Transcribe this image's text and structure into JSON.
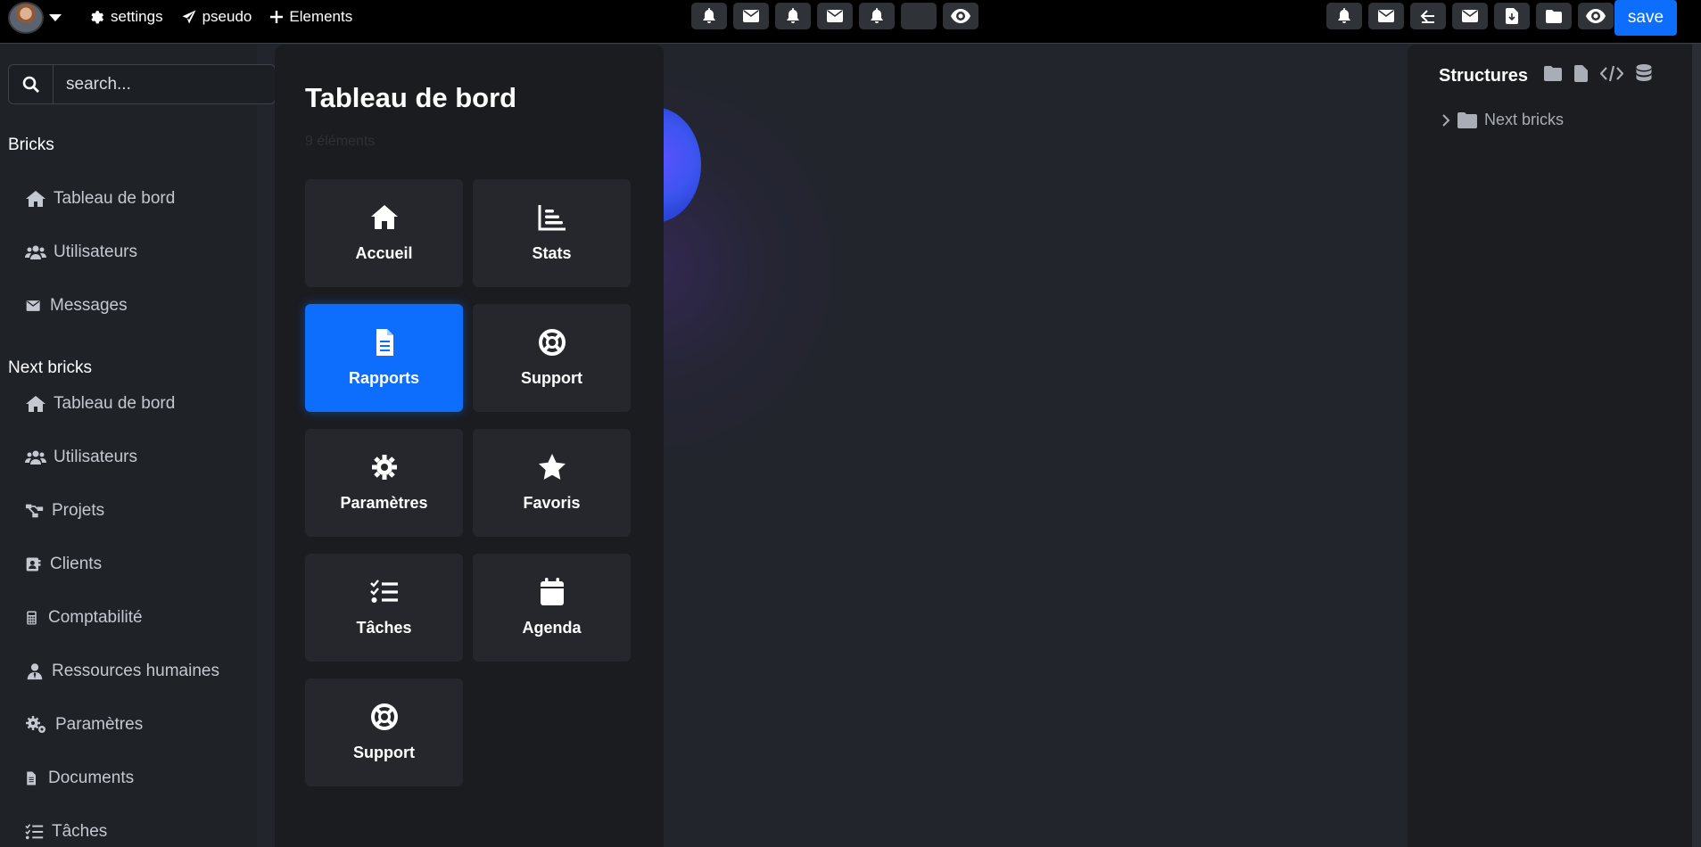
{
  "topbar": {
    "nav": [
      {
        "icon": "gear-icon",
        "label": "settings"
      },
      {
        "icon": "paper-plane-icon",
        "label": "pseudo"
      },
      {
        "icon": "plus-icon",
        "label": "Elements"
      }
    ],
    "center_tools": [
      "bell-icon",
      "envelope-icon",
      "bell-icon",
      "envelope-icon",
      "bell-icon",
      "blank",
      "eye-icon"
    ],
    "right_tools": [
      "bell-icon",
      "envelope-icon",
      "arrow-left-icon",
      "envelope-icon",
      "file-download-icon",
      "folder-icon",
      "eye-icon"
    ],
    "save_label": "save"
  },
  "sidebar": {
    "search_placeholder": "search...",
    "section1_title": "Bricks",
    "section1_items": [
      {
        "icon": "home-icon",
        "label": "Tableau de bord"
      },
      {
        "icon": "users-icon",
        "label": "Utilisateurs"
      },
      {
        "icon": "envelope-icon",
        "label": "Messages"
      }
    ],
    "section2_title": "Next bricks",
    "section2_items": [
      {
        "icon": "home-icon",
        "label": "Tableau de bord"
      },
      {
        "icon": "users-icon",
        "label": "Utilisateurs"
      },
      {
        "icon": "sitemap-icon",
        "label": "Projets"
      },
      {
        "icon": "address-book-icon",
        "label": "Clients"
      },
      {
        "icon": "calculator-icon",
        "label": "Comptabilité"
      },
      {
        "icon": "user-tie-icon",
        "label": "Ressources humaines"
      },
      {
        "icon": "gears-icon",
        "label": "Paramètres"
      },
      {
        "icon": "document-icon",
        "label": "Documents"
      },
      {
        "icon": "list-check-icon",
        "label": "Tâches"
      }
    ]
  },
  "panel": {
    "title": "Tableau de bord",
    "subtitle": "9 éléments",
    "tiles": [
      {
        "icon": "home-icon",
        "label": "Accueil",
        "active": false
      },
      {
        "icon": "chart-icon",
        "label": "Stats",
        "active": false
      },
      {
        "icon": "file-icon",
        "label": "Rapports",
        "active": true
      },
      {
        "icon": "lifebuoy-icon",
        "label": "Support",
        "active": false
      },
      {
        "icon": "gear-icon",
        "label": "Paramètres",
        "active": false
      },
      {
        "icon": "star-icon",
        "label": "Favoris",
        "active": false
      },
      {
        "icon": "list-check-icon",
        "label": "Tâches",
        "active": false
      },
      {
        "icon": "calendar-icon",
        "label": "Agenda",
        "active": false
      },
      {
        "icon": "lifebuoy-icon",
        "label": "Support",
        "active": false
      }
    ]
  },
  "structures": {
    "title": "Structures",
    "icons": [
      "folder-icon",
      "file-icon",
      "code-icon",
      "database-icon"
    ],
    "tree": [
      {
        "label": "Next bricks",
        "icon": "folder-icon"
      }
    ]
  },
  "colors": {
    "accent": "#0d6efd",
    "background": "#22252b",
    "panel": "#1b1c1f",
    "tile": "#25272d"
  }
}
